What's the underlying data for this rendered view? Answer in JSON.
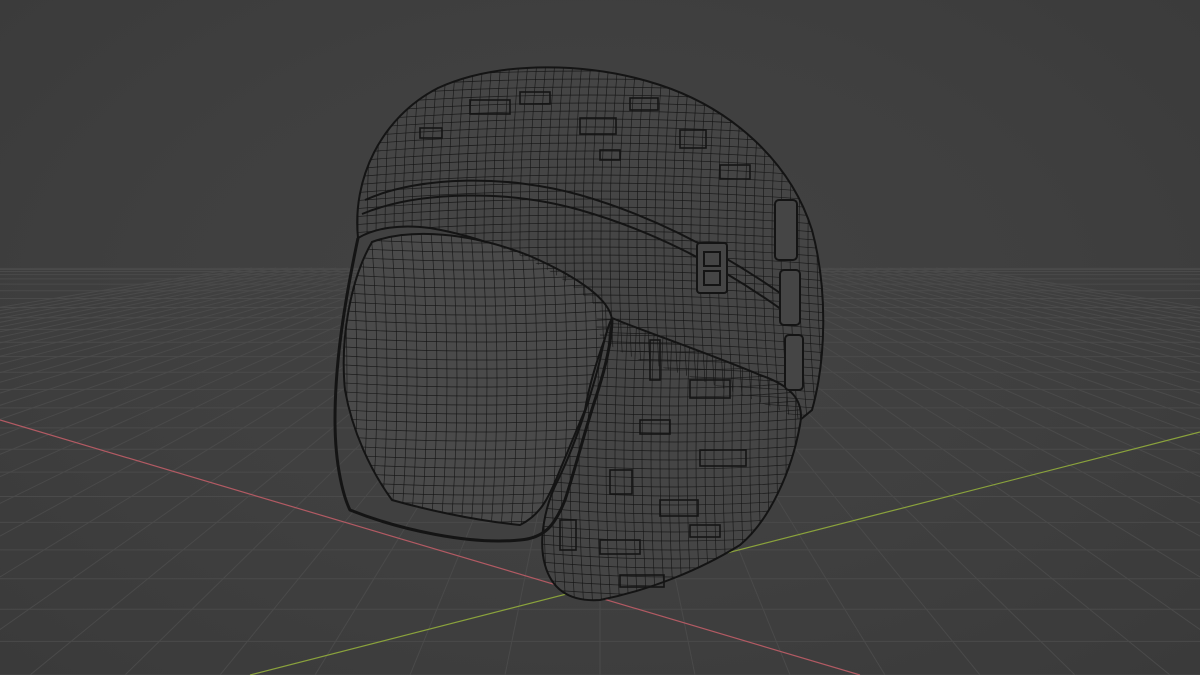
{
  "viewport": {
    "mode": "wireframe",
    "background_color": "#3d3d3d",
    "grid_line_color": "#4a4a4a",
    "x_axis_color": "#b25a63",
    "y_axis_color": "#8aa23c",
    "wire_color": "#141414",
    "mesh_fill_color": "#454545"
  },
  "object": {
    "type": "helmet-mesh",
    "display": "wireframe"
  }
}
